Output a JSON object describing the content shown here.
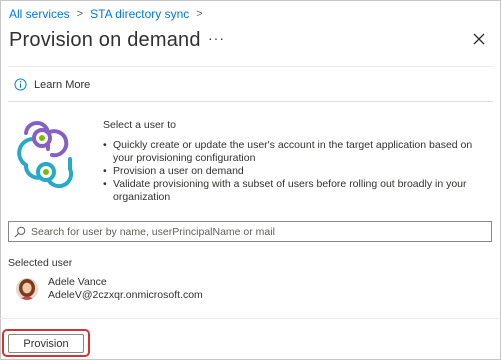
{
  "breadcrumb": {
    "items": [
      "All services",
      "STA directory sync"
    ],
    "separator": ">"
  },
  "header": {
    "title": "Provision on demand",
    "more_label": "···"
  },
  "learn_more": {
    "label": "Learn More",
    "icon": "info-icon"
  },
  "intro": {
    "heading": "Select a user to",
    "bullets": [
      "Quickly create or update the user's account in the target application based on your provisioning configuration",
      "Provision a user on demand",
      "Validate provisioning with a subset of users before rolling out broadly in your organization"
    ],
    "logo_icon": "provisioning-sync-logo"
  },
  "search": {
    "placeholder": "Search for user by name, userPrincipalName or mail",
    "value": ""
  },
  "selected": {
    "label": "Selected user",
    "name": "Adele Vance",
    "email": "AdeleV@2czxqr.onmicrosoft.com"
  },
  "footer": {
    "provision_label": "Provision"
  },
  "colors": {
    "link": "#0078d4",
    "highlight_border": "#d13438",
    "logo_purple": "#8661c5",
    "logo_teal": "#29a9c9",
    "logo_green": "#7fba00"
  }
}
